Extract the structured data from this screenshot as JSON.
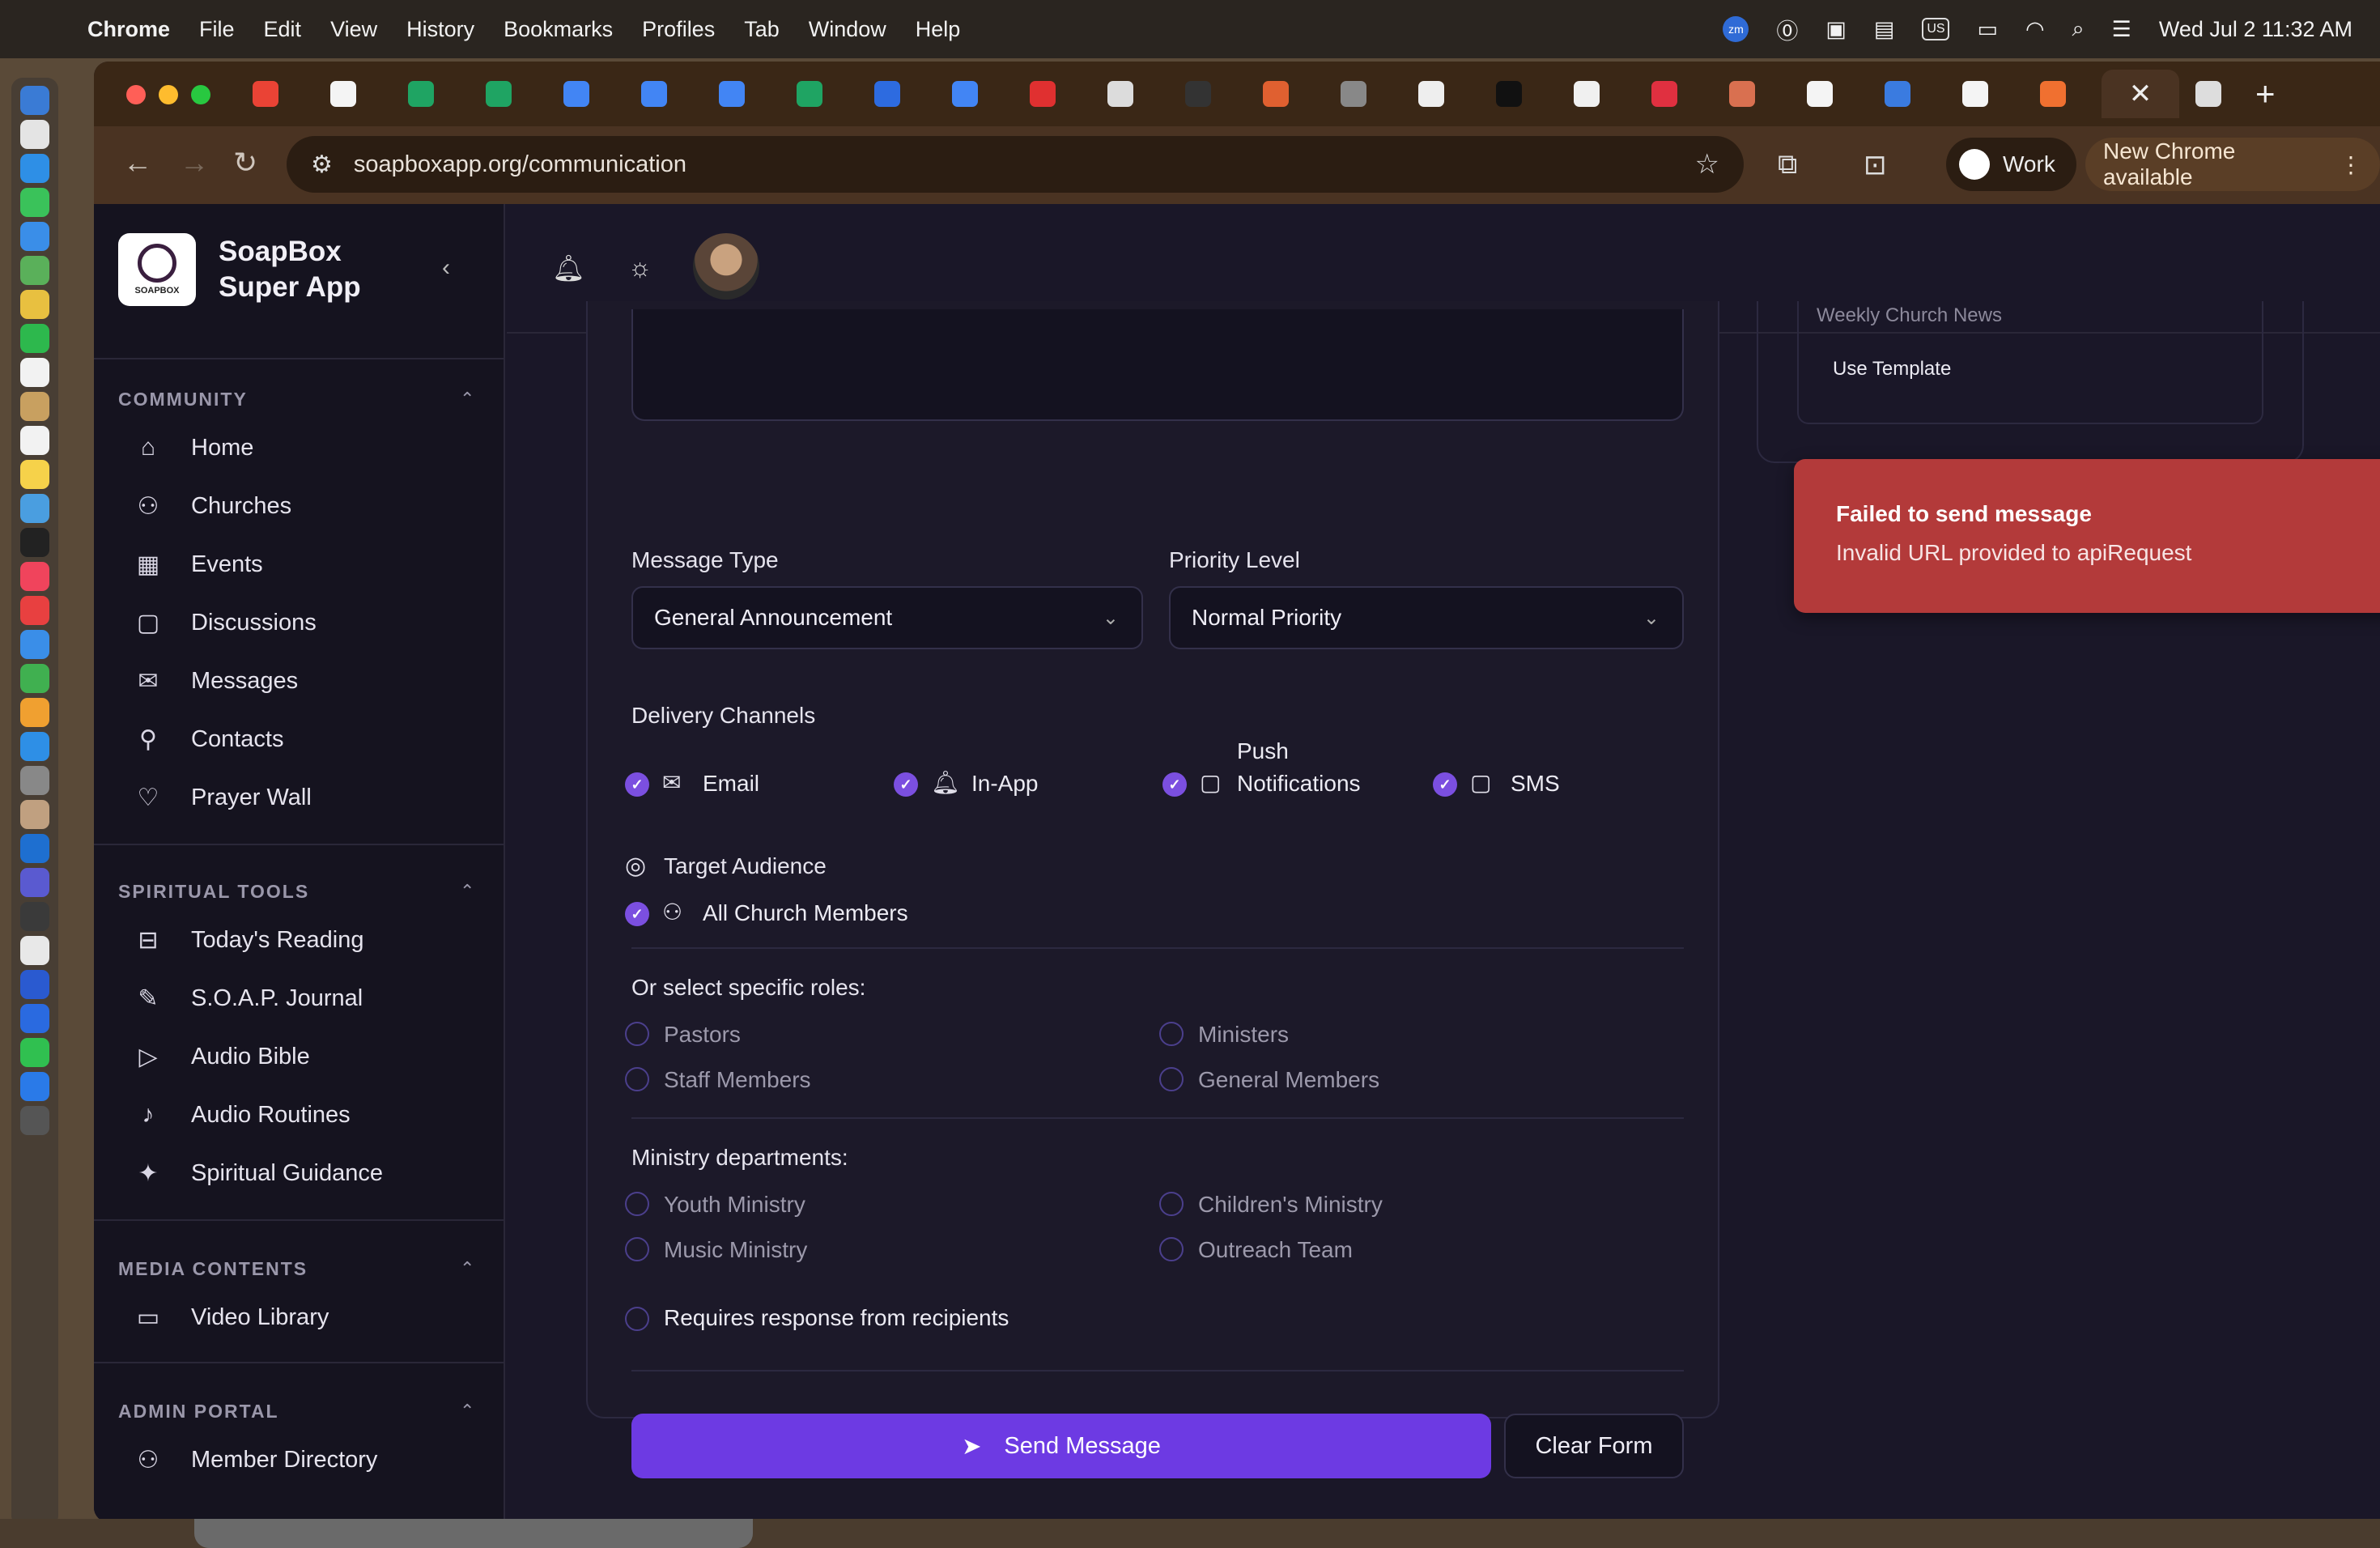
{
  "menubar": {
    "items": [
      "Chrome",
      "File",
      "Edit",
      "View",
      "History",
      "Bookmarks",
      "Profiles",
      "Tab",
      "Window",
      "Help"
    ],
    "keyboard": "US",
    "datetime": "Wed Jul 2  11:32 AM",
    "zoom_badge": "zm"
  },
  "browser": {
    "url": "soapboxapp.org/communication",
    "profile_label": "Work",
    "update_label": "New Chrome available",
    "tab_close": "✕",
    "new_tab": "+"
  },
  "app": {
    "brand": {
      "name": "SoapBox Super App",
      "logo_text": "SOAPBOX"
    },
    "sections": [
      {
        "title": "COMMUNITY",
        "items": [
          "Home",
          "Churches",
          "Events",
          "Discussions",
          "Messages",
          "Contacts",
          "Prayer Wall"
        ]
      },
      {
        "title": "SPIRITUAL TOOLS",
        "items": [
          "Today's Reading",
          "S.O.A.P. Journal",
          "Audio Bible",
          "Audio Routines",
          "Spiritual Guidance"
        ]
      },
      {
        "title": "MEDIA CONTENTS",
        "items": [
          "Video Library"
        ]
      },
      {
        "title": "ADMIN PORTAL",
        "items": [
          "Member Directory"
        ]
      }
    ]
  },
  "form": {
    "message_type_label": "Message Type",
    "message_type_value": "General Announcement",
    "priority_label": "Priority Level",
    "priority_value": "Normal Priority",
    "delivery_label": "Delivery Channels",
    "channels": [
      "Email",
      "In-App",
      "Push Notifications",
      "SMS"
    ],
    "target_label": "Target Audience",
    "all_members": "All Church Members",
    "roles_label": "Or select specific roles:",
    "roles": [
      "Pastors",
      "Ministers",
      "Staff Members",
      "General Members"
    ],
    "departments_label": "Ministry departments:",
    "departments": [
      "Youth Ministry",
      "Children's Ministry",
      "Music Ministry",
      "Outreach Team"
    ],
    "requires_response": "Requires response from recipients",
    "send_label": "Send Message",
    "clear_label": "Clear Form"
  },
  "template": {
    "name": "Weekly Church News",
    "use_label": "Use Template"
  },
  "toast": {
    "title": "Failed to send message",
    "message": "Invalid URL provided to apiRequest"
  },
  "colors": {
    "accent": "#6d3ae3",
    "error": "#b33a3a",
    "sidebar_bg": "#15131f",
    "app_bg": "#1a1728"
  }
}
